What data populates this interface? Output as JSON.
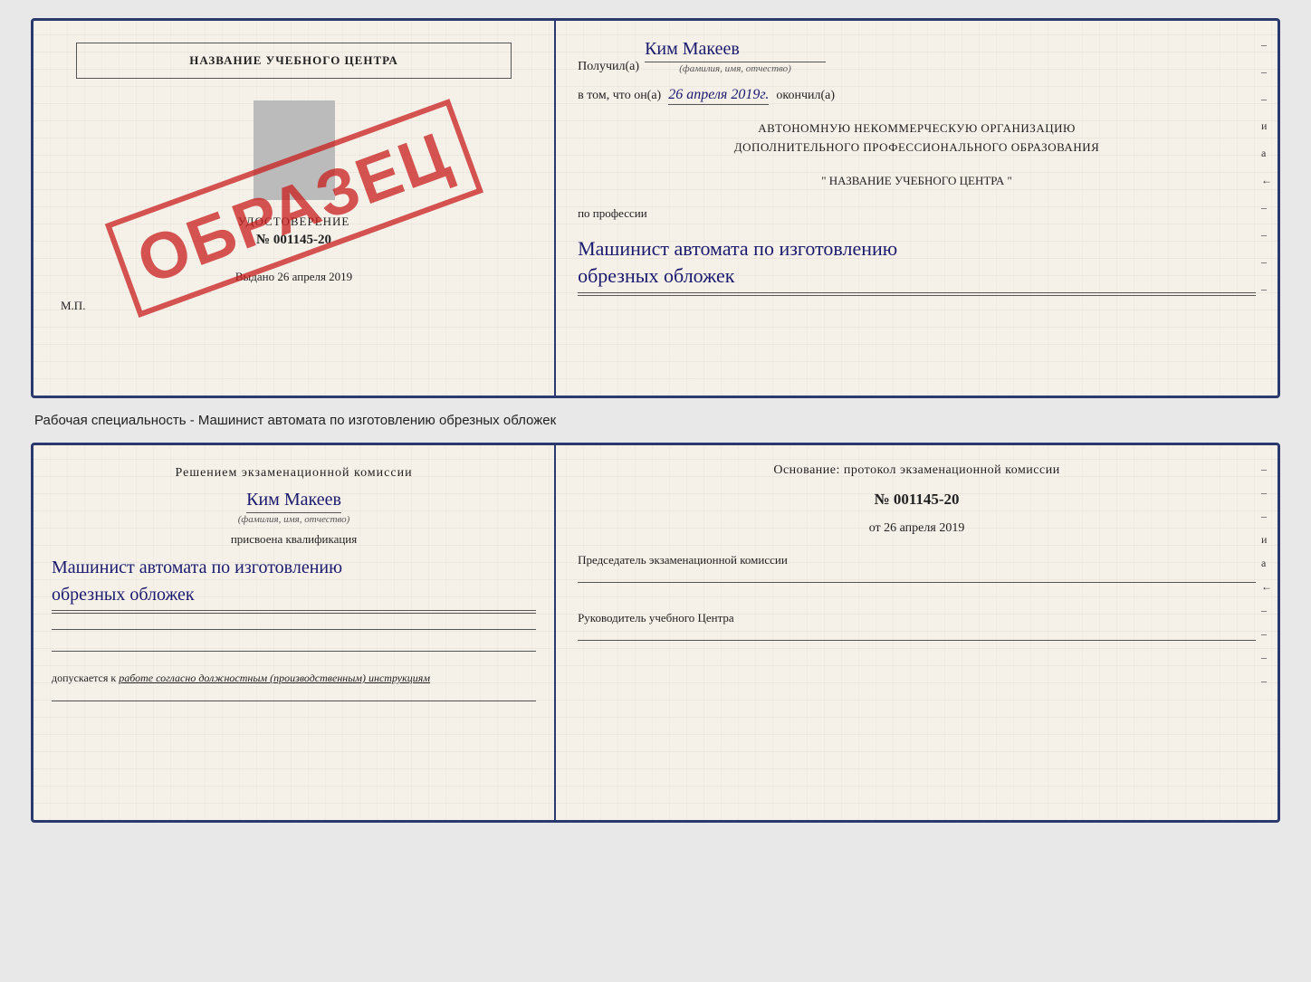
{
  "top_card": {
    "left": {
      "center_name": "НАЗВАНИЕ УЧЕБНОГО ЦЕНТРА",
      "stamp_text": "ОБРАЗЕЦ",
      "udostoverenie_label": "УДОСТОВЕРЕНИЕ",
      "doc_number": "№ 001145-20",
      "vydano_prefix": "Выдано",
      "vydano_date": "26 апреля 2019",
      "mp_label": "М.П."
    },
    "right": {
      "poluchil_prefix": "Получил(а)",
      "poluchil_name": "Ким Макеев",
      "fio_sublabel": "(фамилия, имя, отчество)",
      "vtom_prefix": "в том, что он(а)",
      "vtom_date": "26 апреля 2019г.",
      "okончил_suffix": "окончил(а)",
      "org_line1": "АВТОНОМНУЮ НЕКОММЕРЧЕСКУЮ ОРГАНИЗАЦИЮ",
      "org_line2": "ДОПОЛНИТЕЛЬНОГО ПРОФЕССИОНАЛЬНОГО ОБРАЗОВАНИЯ",
      "org_name": "\" НАЗВАНИЕ УЧЕБНОГО ЦЕНТРА \"",
      "po_professii_label": "по профессии",
      "profession_line1": "Машинист автомата по изготовлению",
      "profession_line2": "обрезных обложек",
      "side_marks": [
        "-",
        "-",
        "-",
        "и",
        "а",
        "←",
        "-",
        "-",
        "-",
        "-"
      ]
    }
  },
  "caption": "Рабочая специальность - Машинист автомата по изготовлению обрезных обложек",
  "bottom_card": {
    "left": {
      "resheniem_title": "Решением экзаменационной комиссии",
      "fio_name": "Ким Макеев",
      "fio_sublabel": "(фамилия, имя, отчество)",
      "prisvoena_label": "присвоена квалификация",
      "kval_line1": "Машинист автомата по изготовлению",
      "kval_line2": "обрезных обложек",
      "dopuskaetsya_prefix": "допускается к",
      "dopuskaetsya_text": "работе согласно должностным (производственным) инструкциям"
    },
    "right": {
      "osnovanie_label": "Основание: протокол экзаменационной комиссии",
      "proto_number": "№ 001145-20",
      "ot_prefix": "от",
      "ot_date": "26 апреля 2019",
      "predsedatel_label": "Председатель экзаменационной комиссии",
      "rukovoditel_label": "Руководитель учебного Центра",
      "side_marks": [
        "-",
        "-",
        "-",
        "и",
        "а",
        "←",
        "-",
        "-",
        "-",
        "-"
      ]
    }
  }
}
